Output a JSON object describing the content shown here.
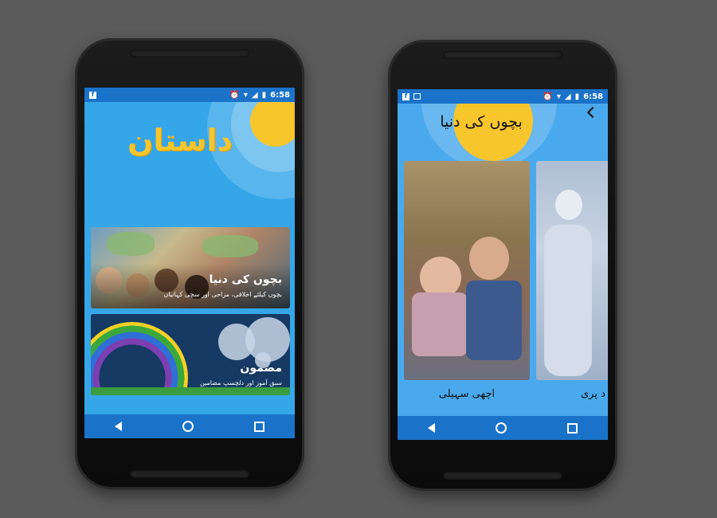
{
  "colors": {
    "background": "#5b5b5b",
    "status_bar": "#1a73c9",
    "screen_blue": "#35a6e8",
    "sun_yellow": "#f7c52c"
  },
  "left_screen": {
    "status": {
      "time": "6:58",
      "left_icons": [
        "facebook-icon"
      ],
      "right_icons": [
        "alarm-icon",
        "wifi-icon",
        "signal-icon",
        "battery-icon"
      ]
    },
    "logo_text": "داستان",
    "cards": [
      {
        "title": "بچوں کی دنیا",
        "subtitle": "بچوں کیلئے اخلاقی، مزاحی اور سچی کہانیاں"
      },
      {
        "title": "مضمون",
        "subtitle": "سبق آموز اور دلچسپ مضامین"
      }
    ]
  },
  "right_screen": {
    "status": {
      "time": "6:58",
      "left_icons": [
        "facebook-icon",
        "image-icon"
      ],
      "right_icons": [
        "alarm-icon",
        "wifi-icon",
        "signal-icon",
        "battery-icon"
      ]
    },
    "title": "بچوں کی دنیا",
    "stories": [
      {
        "label": "اچھی سہیلی"
      },
      {
        "label": "د پری"
      }
    ]
  },
  "nav_icons": [
    "back-icon",
    "home-icon",
    "recent-apps-icon"
  ]
}
